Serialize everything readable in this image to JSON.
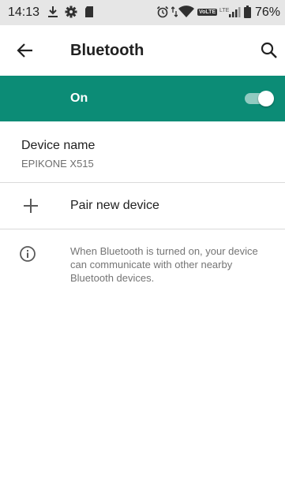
{
  "status_bar": {
    "time": "14:13",
    "volte": "VoLTE",
    "lte": "LTE",
    "battery": "76%"
  },
  "toolbar": {
    "title": "Bluetooth",
    "back_icon": "arrow-back-icon",
    "search_icon": "search-icon"
  },
  "master_switch": {
    "label": "On",
    "checked": true,
    "color": "#0c8c76"
  },
  "device_name": {
    "title": "Device name",
    "value": "EPIKONE X515"
  },
  "pair_new_device": {
    "icon": "plus-icon",
    "label": "Pair new device"
  },
  "info": {
    "icon": "info-icon",
    "text": "When Bluetooth is turned on, your device can communicate with other nearby Bluetooth devices."
  }
}
